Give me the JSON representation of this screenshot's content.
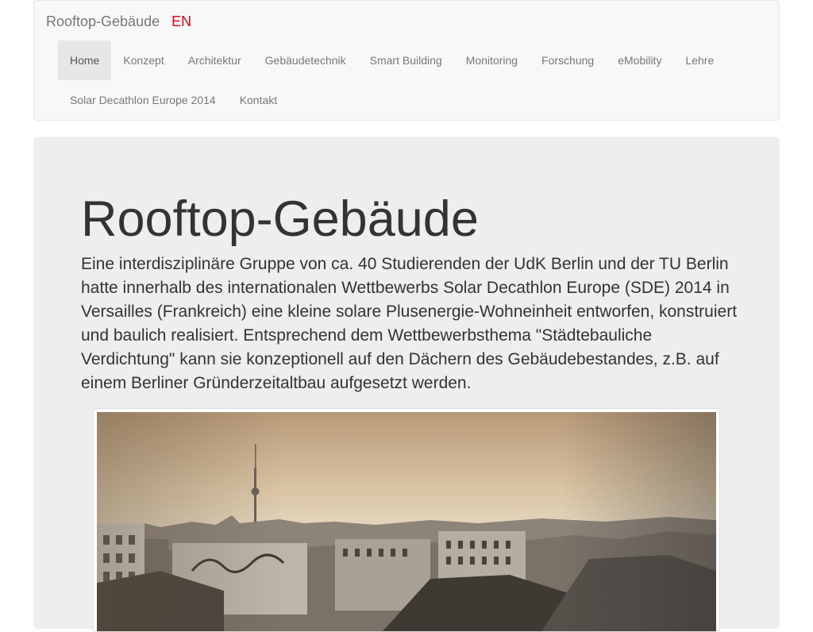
{
  "navbar": {
    "brand": "Rooftop-Gebäude",
    "lang": "EN",
    "items": [
      {
        "label": "Home",
        "active": true
      },
      {
        "label": "Konzept"
      },
      {
        "label": "Architektur"
      },
      {
        "label": "Gebäudetechnik"
      },
      {
        "label": "Smart Building"
      },
      {
        "label": "Monitoring"
      },
      {
        "label": "Forschung"
      },
      {
        "label": "eMobility"
      },
      {
        "label": "Lehre"
      },
      {
        "label": "Solar Decathlon Europe 2014"
      },
      {
        "label": "Kontakt"
      }
    ]
  },
  "hero": {
    "title": "Rooftop-Gebäude",
    "lead": "Eine interdisziplinäre Gruppe von ca. 40 Studierenden der UdK Berlin und der TU Berlin hatte innerhalb des internationalen Wettbewerbs Solar Decathlon Europe (SDE) 2014 in Versailles (Frankreich) eine kleine solare Plusenergie-Wohneinheit entworfen, konstruiert und baulich realisiert. Entsprechend dem Wettbewerbsthema \"Städtebauliche Verdichtung\" kann sie konzeptionell auf den Dächern des Gebäudebestandes, z.B. auf einem Berliner Gründerzeitaltbau aufgesetzt werden."
  },
  "colors": {
    "lang_accent": "#e0000f",
    "navbar_bg": "#f8f8f8",
    "jumbotron_bg": "#eeeeee"
  }
}
